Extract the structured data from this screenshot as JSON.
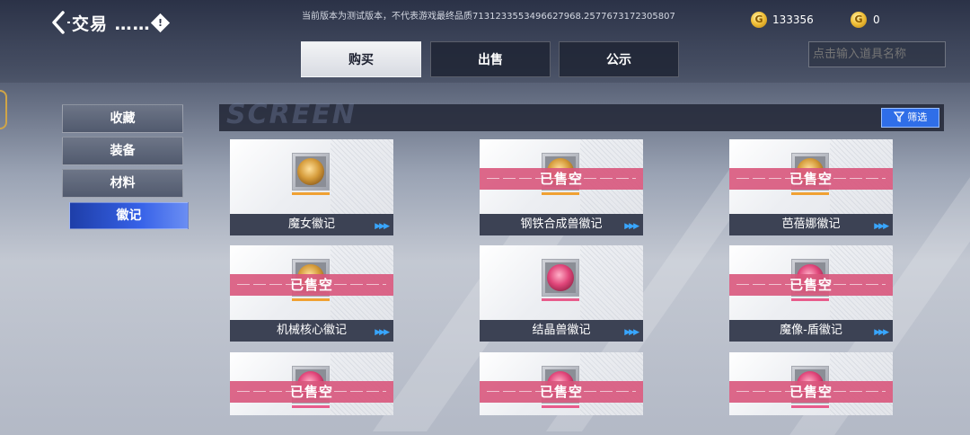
{
  "header": {
    "title": "交易 ……",
    "info_icon_glyph": "!",
    "notice": "当前版本为测试版本，不代表游戏最终品质7131233553496627968.2577673172305807"
  },
  "currency": [
    {
      "icon": "gold-coin-icon",
      "glyph": "G",
      "value": "133356"
    },
    {
      "icon": "special-coin-icon",
      "glyph": "G",
      "value": "0"
    }
  ],
  "tabs": [
    {
      "label": "购买",
      "active": true
    },
    {
      "label": "出售",
      "active": false
    },
    {
      "label": "公示",
      "active": false
    }
  ],
  "search": {
    "placeholder": "点击输入道具名称"
  },
  "sidebar": {
    "items": [
      {
        "label": "收藏"
      },
      {
        "label": "装备"
      },
      {
        "label": "材料"
      },
      {
        "label": "徽记"
      }
    ]
  },
  "filter_bar": {
    "watermark": "SCREEN",
    "filter_label": "筛选"
  },
  "sold_out_label": "已售空",
  "colors": {
    "rarity_orange": "#f0a133",
    "rarity_pink": "#e85c8c",
    "accent_blue": "#2f6ee8",
    "sold_band": "#d8567c"
  },
  "items": [
    {
      "name": "魔女徽记",
      "sold_out": false,
      "rarity": "orange"
    },
    {
      "name": "钢铁合成兽徽记",
      "sold_out": true,
      "rarity": "orange"
    },
    {
      "name": "芭蓓娜徽记",
      "sold_out": true,
      "rarity": "orange"
    },
    {
      "name": "机械核心徽记",
      "sold_out": true,
      "rarity": "orange"
    },
    {
      "name": "结晶兽徽记",
      "sold_out": false,
      "rarity": "pink"
    },
    {
      "name": "魔像-盾徽记",
      "sold_out": true,
      "rarity": "pink"
    },
    {
      "name": "",
      "sold_out": true,
      "rarity": "pink"
    },
    {
      "name": "",
      "sold_out": true,
      "rarity": "pink"
    },
    {
      "name": "",
      "sold_out": true,
      "rarity": "pink"
    }
  ]
}
